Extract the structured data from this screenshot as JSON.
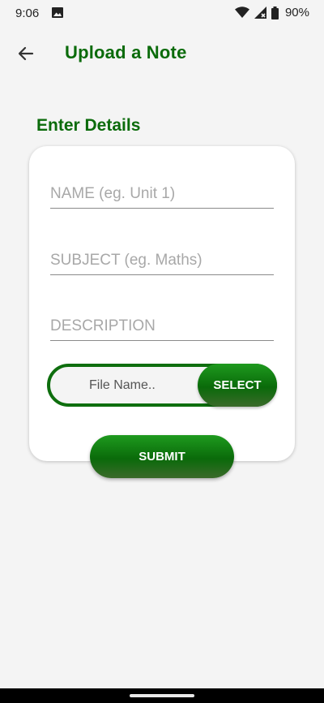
{
  "status_bar": {
    "time": "9:06",
    "battery": "90%",
    "icons": [
      "gallery-icon",
      "wifi-icon",
      "cell-signal-icon",
      "battery-icon"
    ]
  },
  "app_bar": {
    "title": "Upload a Note",
    "back_icon": "back-arrow-icon"
  },
  "form": {
    "section_title": "Enter Details",
    "name_field": {
      "placeholder": "NAME (eg. Unit 1)",
      "value": ""
    },
    "subject_field": {
      "placeholder": "SUBJECT (eg. Maths)",
      "value": ""
    },
    "description_field": {
      "placeholder": "DESCRIPTION",
      "value": ""
    },
    "file_name": "File Name..",
    "select_label": "SELECT",
    "submit_label": "SUBMIT"
  },
  "colors": {
    "accent_green": "#0b6b0b",
    "button_green": "#0e7a0e",
    "background": "#f4f4f4",
    "card": "#ffffff"
  }
}
